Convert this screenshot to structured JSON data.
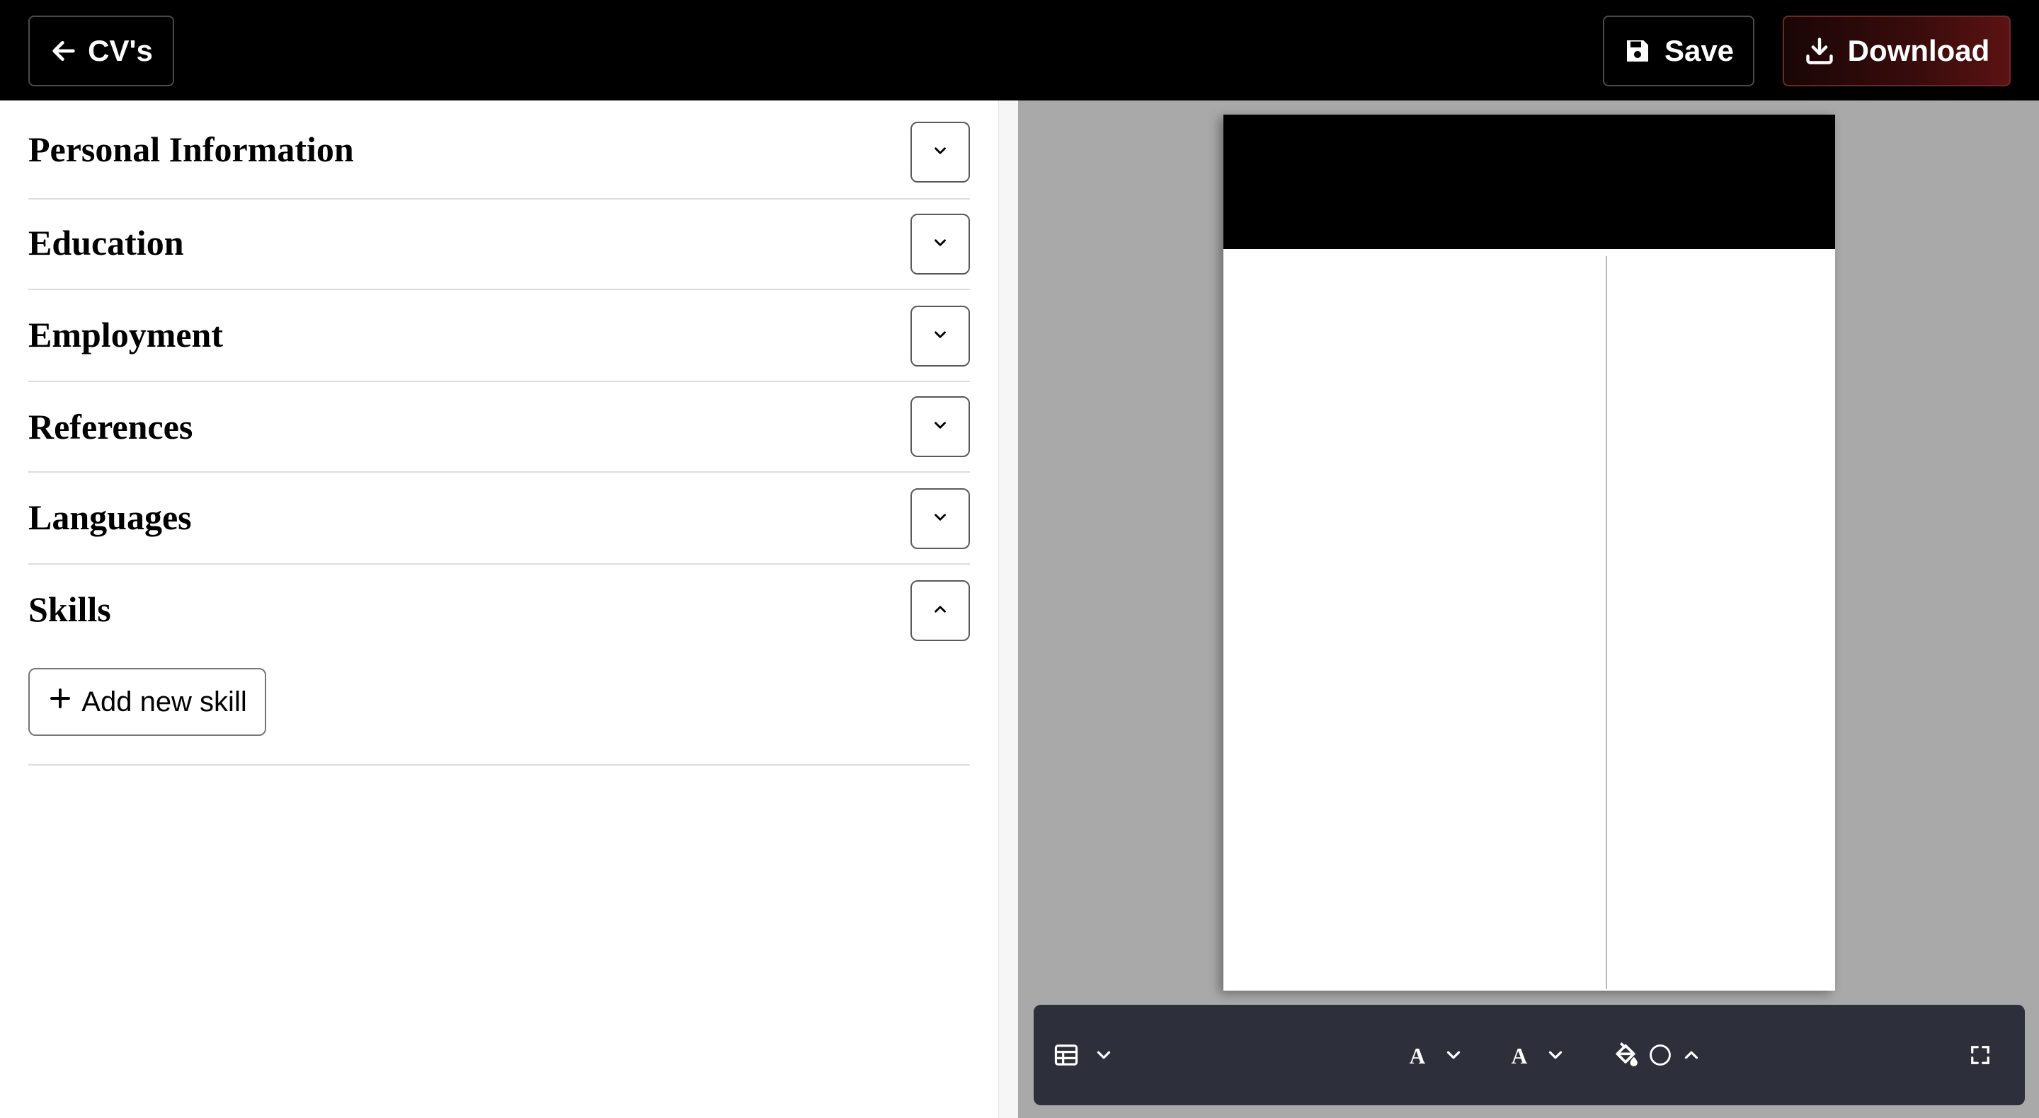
{
  "header": {
    "back_label": "CV's",
    "save_label": "Save",
    "download_label": "Download"
  },
  "sections": [
    {
      "title": "Personal Information",
      "state": "collapsed"
    },
    {
      "title": "Education",
      "state": "collapsed"
    },
    {
      "title": "Employment",
      "state": "collapsed"
    },
    {
      "title": "References",
      "state": "collapsed"
    },
    {
      "title": "Languages",
      "state": "collapsed"
    },
    {
      "title": "Skills",
      "state": "expanded"
    }
  ],
  "skills": {
    "add_label": "Add new skill"
  },
  "toolbar": {
    "layout_icon": "table-icon",
    "font_icon_1": "font-a-icon",
    "font_icon_2": "font-a-icon",
    "paint_icon": "paint-bucket-icon",
    "fullscreen_icon": "expand-icon"
  },
  "colors": {
    "topbar": "#000000",
    "download_gradient_end": "#5c1212",
    "preview_bg": "#a9a9a9",
    "toolbar_bg": "#2d2f3b"
  }
}
